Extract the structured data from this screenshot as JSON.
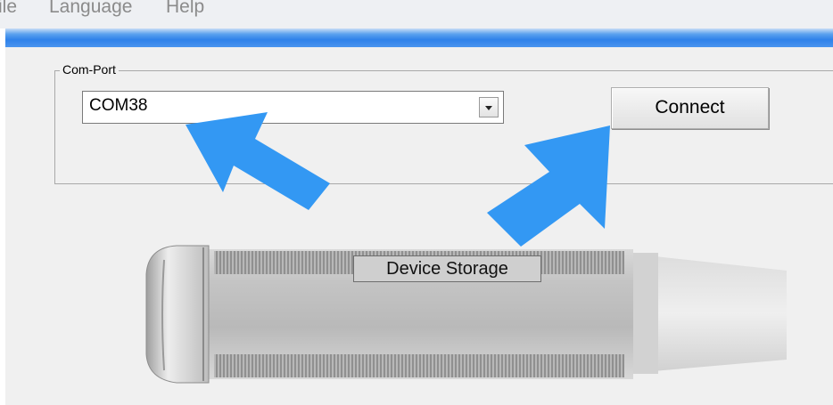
{
  "menu": {
    "items": [
      "ile",
      "Language",
      "Help"
    ]
  },
  "com_port": {
    "group_label": "Com-Port",
    "selected_port": "COM38",
    "connect_label": "Connect"
  },
  "device": {
    "storage_label": "Device Storage"
  },
  "colors": {
    "arrow": "#3398f3",
    "title_bar": "#2f82ea"
  },
  "icons": {
    "dropdown": "chevron-down-icon",
    "annotation_arrows": [
      "arrow-pointing-to-port-icon",
      "arrow-pointing-to-connect-icon"
    ]
  }
}
